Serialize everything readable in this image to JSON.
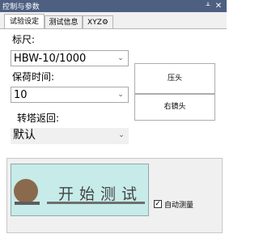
{
  "window": {
    "title": "控制与参数",
    "pin_glyph": "ᚆ",
    "close_glyph": "✕"
  },
  "tabs": [
    {
      "label": "试验设定",
      "active": true
    },
    {
      "label": "测试信息",
      "active": false
    },
    {
      "label": "XYZ⚙",
      "active": false
    }
  ],
  "settings": {
    "scale_label": "标尺:",
    "scale_value": "HBW-10/1000",
    "dwell_label": "保荷时间:",
    "dwell_value": "10",
    "turret_label": "转塔返回:",
    "turret_value": "默认"
  },
  "buttons": {
    "indenter": "压头",
    "right_lens": "右镜头"
  },
  "start": {
    "label": "开始测试",
    "ball_color": "#8a6a4c",
    "bg_color": "#c6ebe8"
  },
  "auto_measure": {
    "label": "自动测量",
    "checked": true,
    "check_glyph": "✓"
  }
}
